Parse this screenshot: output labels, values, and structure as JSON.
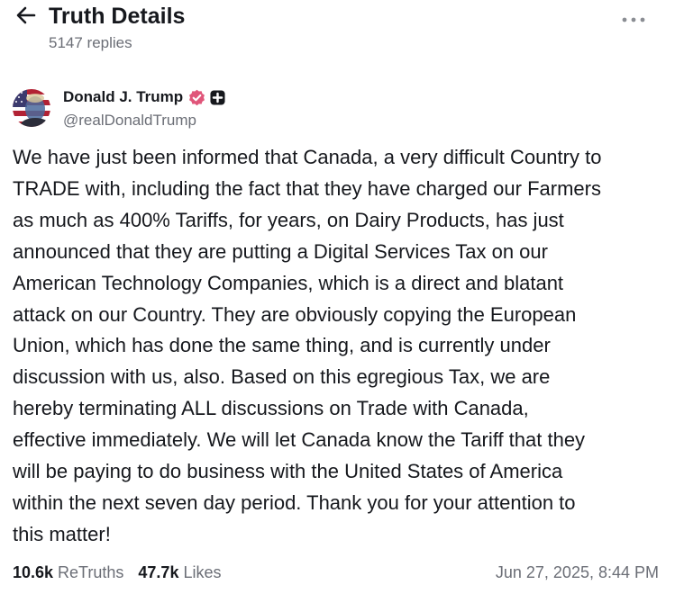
{
  "header": {
    "title": "Truth Details",
    "replies": "5147 replies",
    "back_icon": "arrow-left-icon",
    "more_icon": "more-horizontal-icon"
  },
  "author": {
    "name": "Donald J. Trump",
    "handle": "@realDonaldTrump",
    "verified_icon": "verified-badge-icon",
    "plus_icon": "plus-badge-icon"
  },
  "post": {
    "text": "We have just been informed that Canada, a very difficult Country to\nTRADE with, including the fact that they have charged our Farmers\nas much as 400% Tariffs, for years, on Dairy Products, has just\nannounced that they are putting a Digital Services Tax on our\nAmerican Technology Companies, which is a direct and blatant\nattack on our Country. They are obviously copying the European\nUnion, which has done the same thing, and is currently under\ndiscussion with us, also. Based on this egregious Tax, we are\nhereby terminating ALL discussions on Trade with Canada,\neffective immediately. We will let Canada know the Tariff that they\nwill be paying to do business with the United States of America\nwithin the next seven day period. Thank you for your attention to\nthis matter!"
  },
  "stats": {
    "retruths_count": "10.6k",
    "retruths_label": "ReTruths",
    "likes_count": "47.7k",
    "likes_label": "Likes",
    "timestamp": "Jun 27, 2025, 8:44 PM"
  },
  "colors": {
    "text_primary": "#16181d",
    "text_secondary": "#6b6e76",
    "verified_badge": "#e0567a",
    "plus_badge": "#16181d"
  }
}
